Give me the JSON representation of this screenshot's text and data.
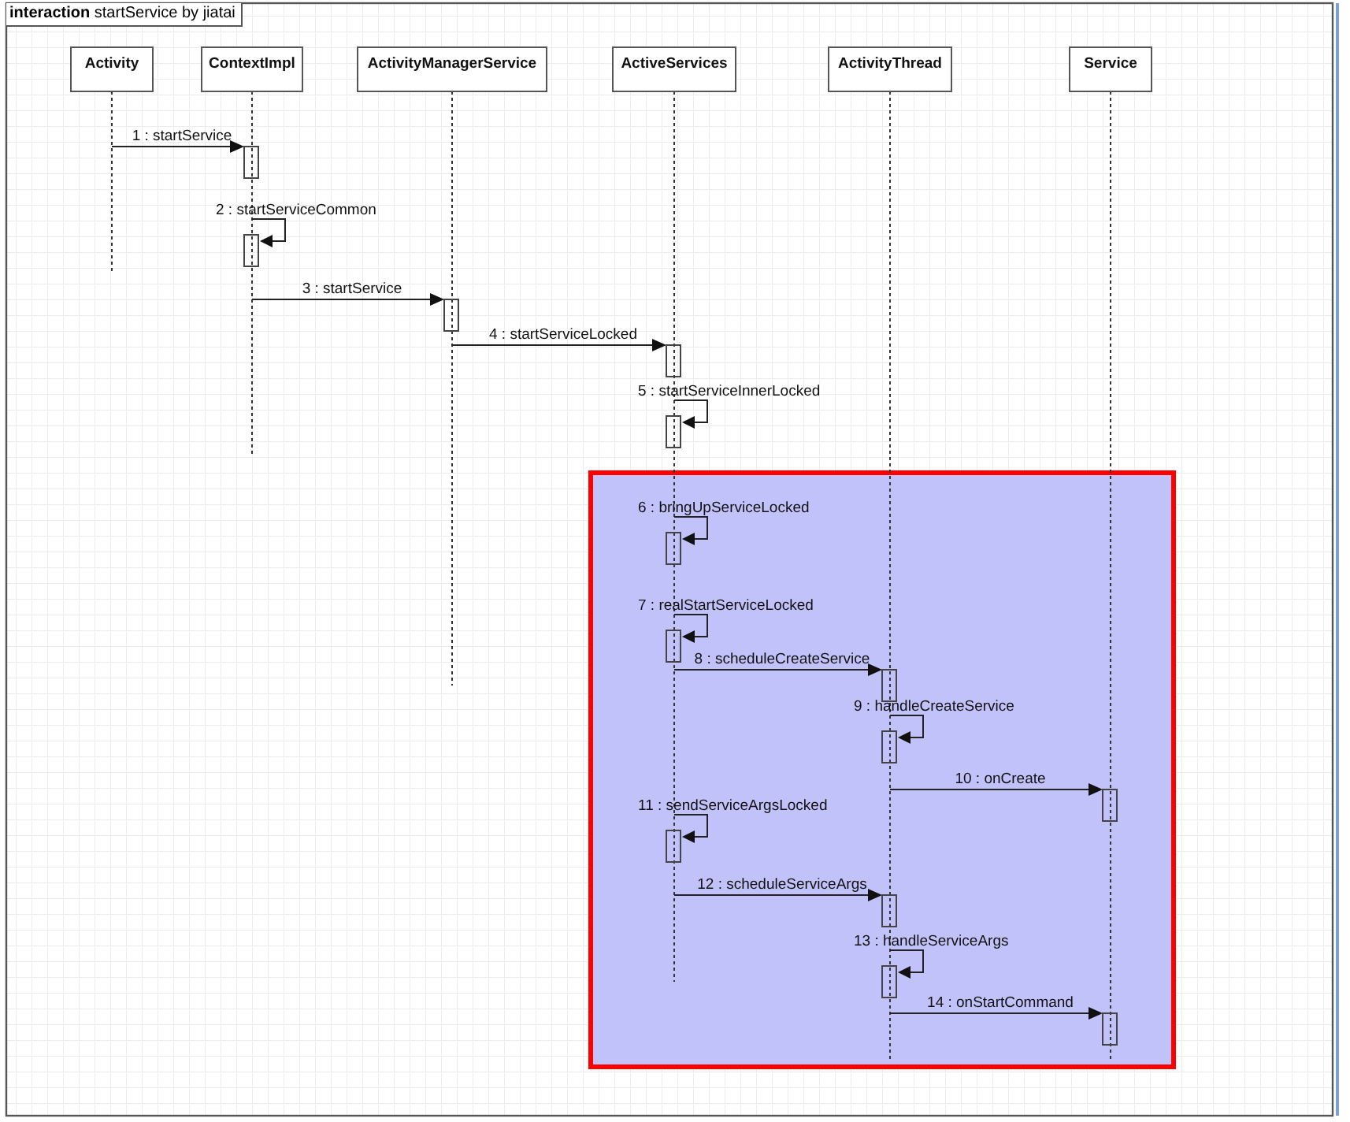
{
  "frame": {
    "title": "**interaction** startService by jiatai"
  },
  "participants": [
    {
      "name": "Activity"
    },
    {
      "name": "ContextImpl"
    },
    {
      "name": "ActivityManagerService"
    },
    {
      "name": "ActiveServices"
    },
    {
      "name": "ActivityThread"
    },
    {
      "name": "Service"
    }
  ],
  "messages": [
    {
      "kind": "call",
      "label": "1 : startService"
    },
    {
      "kind": "self",
      "label": "2 : startServiceCommon"
    },
    {
      "kind": "call",
      "label": "3 : startService"
    },
    {
      "kind": "call",
      "label": "4 : startServiceLocked"
    },
    {
      "kind": "self",
      "label": "5 : startServiceInnerLocked"
    },
    {
      "kind": "self",
      "label": "6 : bringUpServiceLocked"
    },
    {
      "kind": "self",
      "label": "7 : realStartServiceLocked"
    },
    {
      "kind": "call",
      "label": "8 : scheduleCreateService"
    },
    {
      "kind": "self",
      "label": "9 : handleCreateService"
    },
    {
      "kind": "call",
      "label": "10 : onCreate"
    },
    {
      "kind": "self",
      "label": "11 : sendServiceArgsLocked"
    },
    {
      "kind": "call",
      "label": "12 : scheduleServiceArgs"
    },
    {
      "kind": "self",
      "label": "13 : handleServiceArgs"
    },
    {
      "kind": "call",
      "label": "14 : onStartCommand"
    }
  ]
}
